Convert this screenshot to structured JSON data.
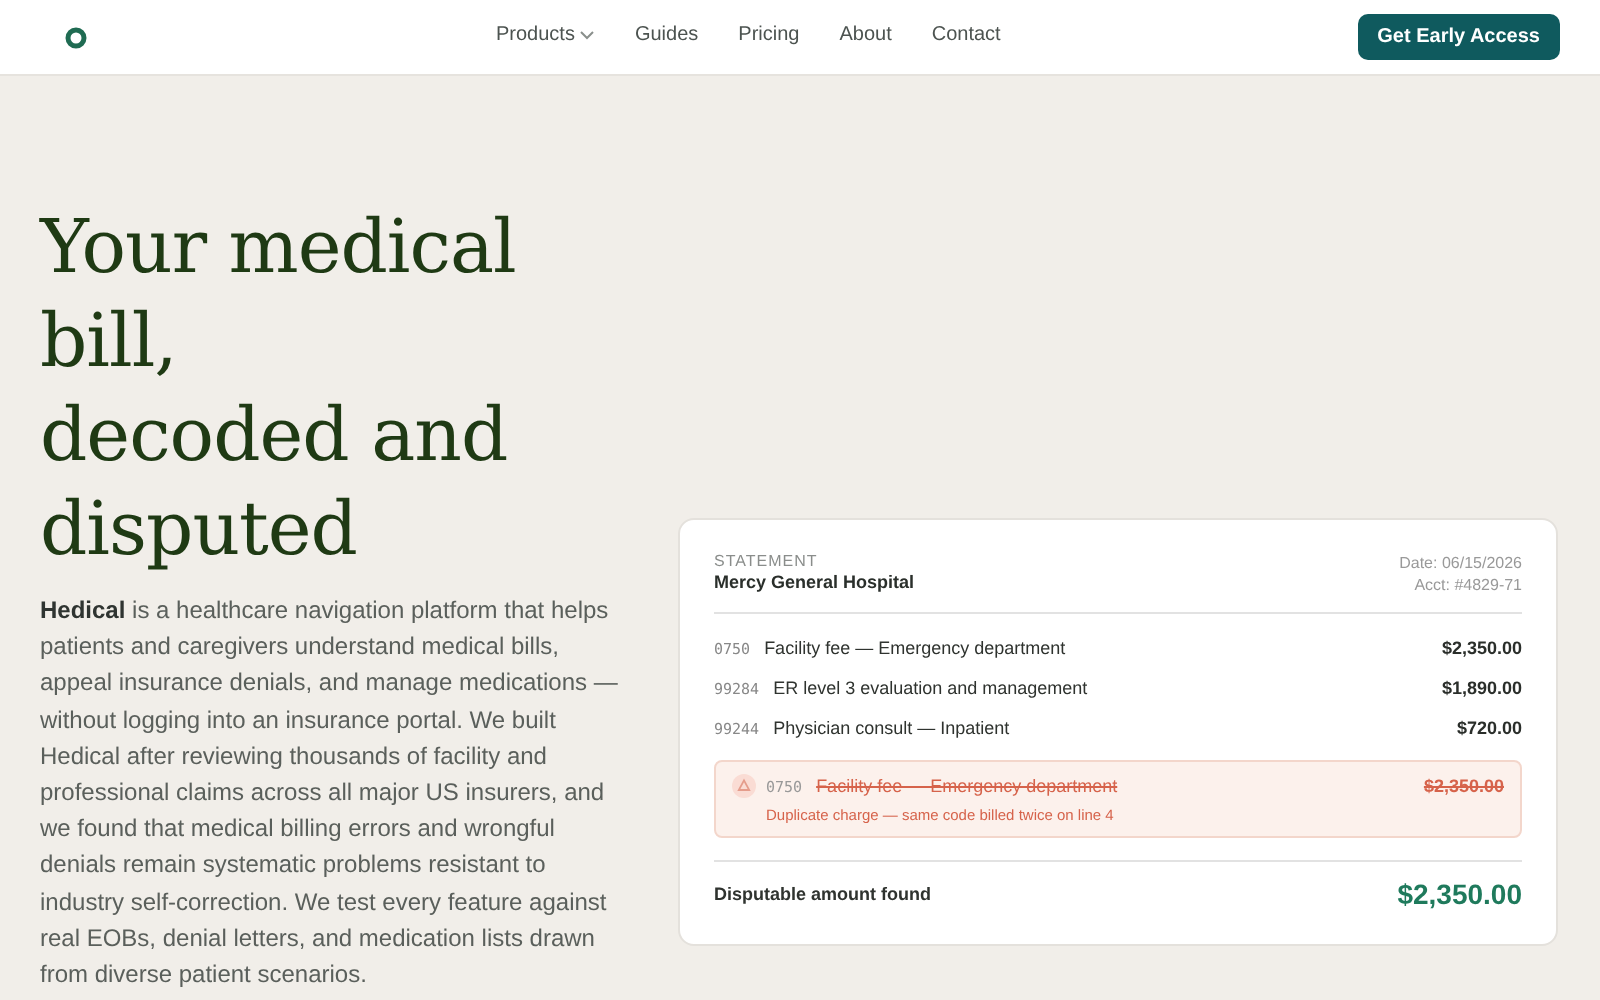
{
  "nav": {
    "links": [
      {
        "label": "Products",
        "dropdown": true
      },
      {
        "label": "Guides",
        "dropdown": false
      },
      {
        "label": "Pricing",
        "dropdown": false
      },
      {
        "label": "About",
        "dropdown": false
      },
      {
        "label": "Contact",
        "dropdown": false
      }
    ],
    "cta": "Get Early Access"
  },
  "hero": {
    "heading_lines": [
      "Your medical bill,",
      "decoded and disputed"
    ],
    "intro": "**Hedical** is a healthcare navigation platform that helps patients and caregivers understand medical bills, appeal insurance denials, and manage medications — without logging into an insurance portal. We built Hedical after reviewing thousands of facility and professional claims across all major US insurers, and we found that medical billing errors and wrongful denials remain systematic problems resistant to industry self-correction. We test every feature against real EOBs, denial letters, and medication lists drawn from diverse patient scenarios."
  },
  "statement": {
    "label": "STATEMENT",
    "provider": "Mercy General Hospital",
    "date": "Date: 06/15/2026",
    "account": "Acct: #4829-71",
    "lines": [
      {
        "code": "0750",
        "description": "Facility fee — Emergency department",
        "amount": "$2,350.00",
        "flagged": false
      },
      {
        "code": "99284",
        "description": "ER level 3 evaluation and management",
        "amount": "$1,890.00",
        "flagged": false
      },
      {
        "code": "99244",
        "description": "Physician consult — Inpatient",
        "amount": "$720.00",
        "flagged": false
      },
      {
        "code": "0750",
        "description": "Facility fee — Emergency department",
        "amount": "$2,350.00",
        "flagged": true,
        "note": "Duplicate charge — same code billed twice on line 4"
      }
    ],
    "total_label": "Disputable amount found",
    "total": "$2,350.00"
  }
}
